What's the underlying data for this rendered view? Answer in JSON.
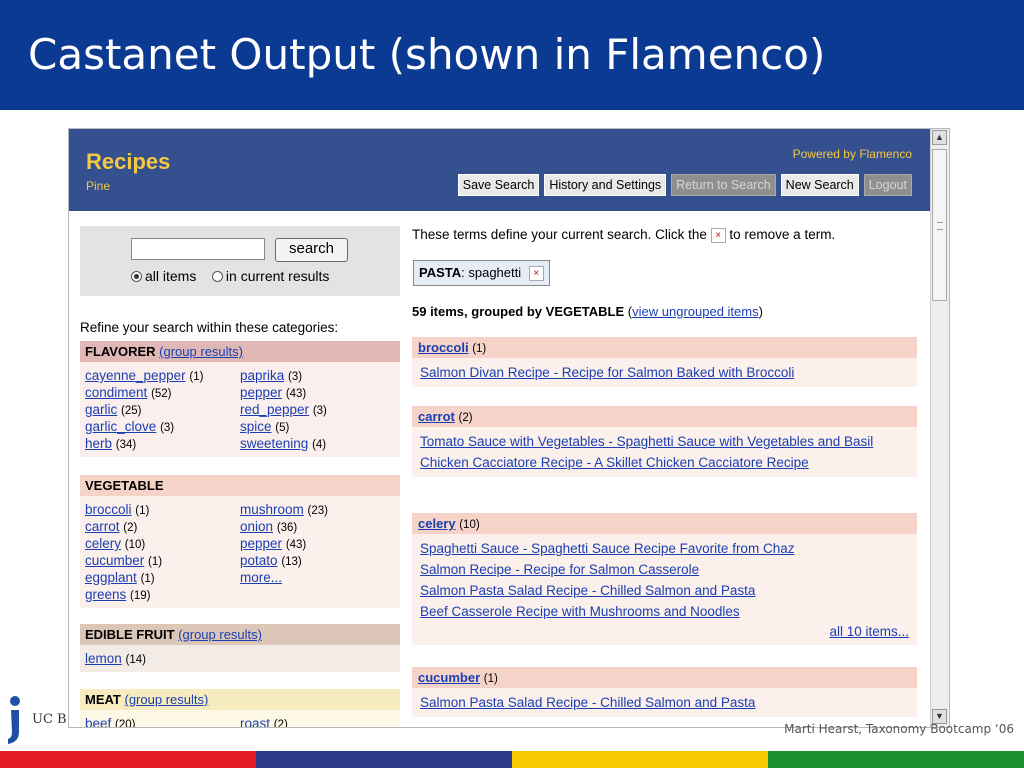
{
  "slide": {
    "title": "Castanet Output (shown in Flamenco)",
    "footer": "Marti Hearst, Taxonomy Bootcamp ‘06",
    "logo_text": "UC Be",
    "stripe_colors": [
      "#e31b23",
      "#2e3a8c",
      "#f7c900",
      "#1b8f2e"
    ],
    "title_bar_color": "#0b3a93"
  },
  "app": {
    "title": "Recipes",
    "subtitle": "Pine",
    "powered_by": "Powered by Flamenco",
    "buttons": {
      "save_search": "Save Search",
      "history_settings": "History and Settings",
      "return_search": "Return to Search",
      "new_search": "New Search",
      "logout": "Logout"
    },
    "accent_color": "#f5c842",
    "header_color": "#34508f"
  },
  "search": {
    "input_value": "",
    "button_label": "search",
    "radio_all": "all items",
    "radio_current": "in current results",
    "selected": "all items"
  },
  "refine": {
    "label": "Refine your search within these categories:",
    "categories": [
      {
        "name": "FLAVORER",
        "group_link": "(group results)",
        "col1": [
          {
            "label": "cayenne_pepper",
            "count": "(1)"
          },
          {
            "label": "condiment",
            "count": "(52)"
          },
          {
            "label": "garlic",
            "count": "(25)"
          },
          {
            "label": "garlic_clove",
            "count": "(3)"
          },
          {
            "label": "herb",
            "count": "(34)"
          }
        ],
        "col2": [
          {
            "label": "paprika",
            "count": "(3)"
          },
          {
            "label": "pepper",
            "count": "(43)"
          },
          {
            "label": "red_pepper",
            "count": "(3)"
          },
          {
            "label": "spice",
            "count": "(5)"
          },
          {
            "label": "sweetening",
            "count": "(4)"
          }
        ]
      },
      {
        "name": "VEGETABLE",
        "group_link": "",
        "col1": [
          {
            "label": "broccoli",
            "count": "(1)"
          },
          {
            "label": "carrot",
            "count": "(2)"
          },
          {
            "label": "celery",
            "count": "(10)"
          },
          {
            "label": "cucumber",
            "count": "(1)"
          },
          {
            "label": "eggplant",
            "count": "(1)"
          },
          {
            "label": "greens",
            "count": "(19)"
          }
        ],
        "col2": [
          {
            "label": "mushroom",
            "count": "(23)"
          },
          {
            "label": "onion",
            "count": "(36)"
          },
          {
            "label": "pepper",
            "count": "(43)"
          },
          {
            "label": "potato",
            "count": "(13)"
          },
          {
            "label": "more...",
            "count": ""
          }
        ]
      },
      {
        "name": "EDIBLE FRUIT",
        "group_link": "(group results)",
        "col1": [
          {
            "label": "lemon",
            "count": "(14)"
          }
        ],
        "col2": []
      },
      {
        "name": "MEAT",
        "group_link": "(group results)",
        "col1": [
          {
            "label": "beef",
            "count": "(20)"
          }
        ],
        "col2": [
          {
            "label": "roast",
            "count": "(2)"
          }
        ]
      }
    ]
  },
  "results": {
    "instruction_before": "These terms define your current search. Click the",
    "instruction_after": "to remove a term.",
    "remove_glyph": "×",
    "term_facet": "PASTA",
    "term_value": ": spaghetti",
    "summary_count": "59 items, grouped by",
    "summary_facet": "VEGETABLE",
    "summary_open": "(",
    "summary_link": "view ungrouped items",
    "summary_close": ")",
    "groups": [
      {
        "name": "broccoli",
        "count": "(1)",
        "items": [
          "Salmon Divan Recipe - Recipe for Salmon Baked with Broccoli"
        ],
        "more": ""
      },
      {
        "name": "carrot",
        "count": "(2)",
        "items": [
          "Tomato Sauce with Vegetables - Spaghetti Sauce with Vegetables and Basil",
          "Chicken Cacciatore Recipe - A Skillet Chicken Cacciatore Recipe"
        ],
        "more": ""
      },
      {
        "name": "celery",
        "count": "(10)",
        "items": [
          "Spaghetti Sauce - Spaghetti Sauce Recipe Favorite from Chaz",
          "Salmon Recipe - Recipe for Salmon Casserole",
          "Salmon Pasta Salad Recipe - Chilled Salmon and Pasta",
          "Beef Casserole Recipe with Mushrooms and Noodles"
        ],
        "more": "all 10 items..."
      },
      {
        "name": "cucumber",
        "count": "(1)",
        "items": [
          "Salmon Pasta Salad Recipe - Chilled Salmon and Pasta"
        ],
        "more": ""
      }
    ]
  },
  "icons": {
    "scroll_up": "▲",
    "scroll_down": "▼",
    "remove_term": "×"
  }
}
